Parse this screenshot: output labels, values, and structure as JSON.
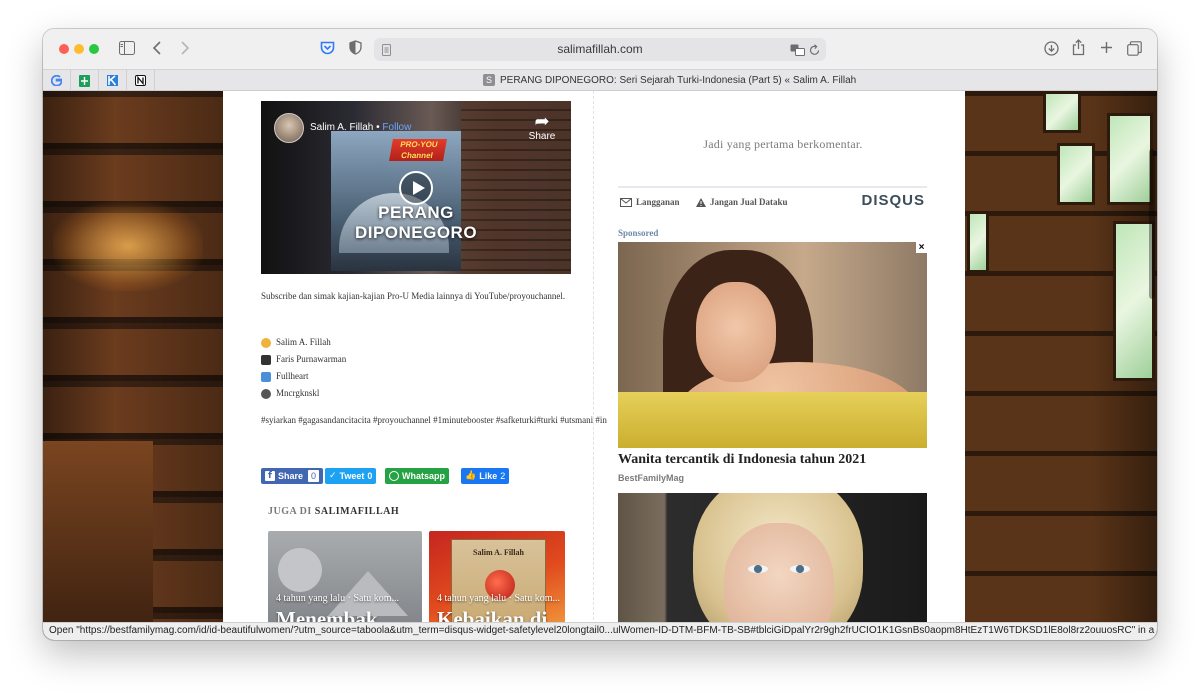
{
  "browser": {
    "url_host": "salimafillah.com",
    "tab_title": "PERANG DIPONEGORO: Seri Sejarah Turki-Indonesia (Part 5) « Salim A. Fillah",
    "tab_favicon_letter": "S",
    "pinned_tabs": [
      "google",
      "sheets",
      "kotlin",
      "notion"
    ],
    "icons": {
      "sidebar": "sidebar-icon",
      "back": "chevron-left-icon",
      "forward": "chevron-right-icon",
      "pocket": "pocket-icon",
      "shield": "shield-icon",
      "page": "page-icon",
      "translate": "translate-icon",
      "reload": "reload-icon",
      "download": "download-icon",
      "share": "share-icon",
      "new_tab": "plus-icon",
      "tab_overview": "tabs-icon"
    }
  },
  "video": {
    "channel": "Salim A. Fillah",
    "follow": "Follow",
    "share": "Share",
    "badge_line1": "PRO-YOU",
    "badge_line2": "Channel",
    "title": "PERANG DIPONEGORO"
  },
  "post": {
    "description": "Subscribe dan simak kajian-kajian Pro-U Media lainnya di YouTube/proyouchannel.",
    "credits": [
      {
        "icon": "person-emoji",
        "name": "Salim A. Fillah",
        "color": "#f0b23a"
      },
      {
        "icon": "clapper-emoji",
        "name": "Faris Purnawarman",
        "color": "#333333"
      },
      {
        "icon": "shirt-emoji",
        "name": "Fullheart",
        "color": "#4a90d9"
      },
      {
        "icon": "speech-emoji",
        "name": "Mncrgknskl",
        "color": "#555555"
      }
    ],
    "tags": "#syiarkan #gagasandancitacita #proyouchannel #1minutebooster #safketurki#turki #utsmani #in"
  },
  "share_buttons": {
    "facebook": {
      "label": "Share",
      "count": "0",
      "color": "#4267b2"
    },
    "twitter": {
      "label": "Tweet",
      "count": "0",
      "color": "#1da1f2"
    },
    "whatsapp": {
      "label": "Whatsapp",
      "color": "#25a244"
    },
    "like": {
      "label": "Like",
      "count": "2",
      "color": "#1877f2"
    }
  },
  "juga_di": {
    "prefix": "JUGA DI",
    "site": "SALIMAFILLAH",
    "cards": [
      {
        "meta": "4 tahun yang lalu · Satu kom...",
        "title": "Menembak"
      },
      {
        "meta": "4 tahun yang lalu · Satu kom...",
        "title": "Kebaikan di",
        "book_author": "Salim A. Fillah"
      }
    ]
  },
  "disqus": {
    "empty_message": "Jadi yang pertama berkomentar.",
    "subscribe": "Langganan",
    "do_not_sell": "Jangan Jual Dataku",
    "brand": "DISQUS",
    "sponsored": "Sponsored",
    "ad1": {
      "title": "Wanita tercantik di Indonesia tahun 2021",
      "source": "BestFamilyMag"
    }
  },
  "status_bar": {
    "text": "Open \"https://bestfamilymag.com/id/id-beautifulwomen/?utm_source=taboola&utm_term=disqus-widget-safetylevel20longtail0...ulWomen-ID-DTM-BFM-TB-SB#tblciGiDpalYr2r9gh2frUCIO1K1GsnBs0aopm8HtEzT1W6TDKSD1lE8ol8rz2ouuosRC\" in a new tab"
  }
}
